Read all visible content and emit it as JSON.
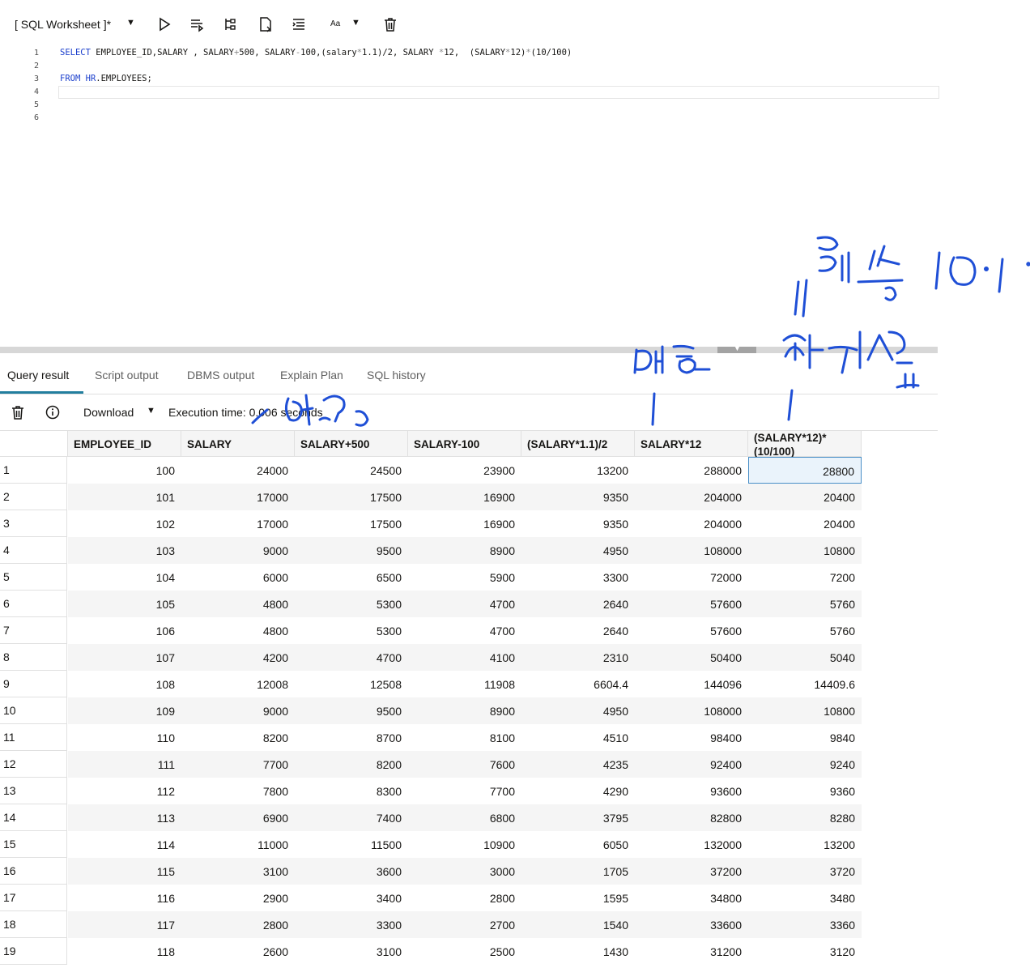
{
  "worksheet": {
    "title": "[ SQL Worksheet ]*",
    "font_button_label": "Aa"
  },
  "editor": {
    "line_numbers": [
      "1",
      "2",
      "3",
      "4",
      "5",
      "6"
    ],
    "line1": {
      "select": "SELECT",
      "cols": " EMPLOYEE_ID,SALARY , SALARY",
      "plus": "+",
      "p500": "500, SALARY",
      "minus": "-",
      "p100": "100,(salary",
      "star1": "*",
      "p11": "1.1)/2, SALARY ",
      "star2": "*",
      "p12": "12,  (SALARY",
      "star3": "*",
      "p12b": "12)",
      "star4": "*",
      "tail": "(10/100)"
    },
    "line3": {
      "from": "FROM",
      "space": " ",
      "schema": "HR",
      "table": ".EMPLOYEES;"
    }
  },
  "result_tabs": [
    "Query result",
    "Script output",
    "DBMS output",
    "Explain Plan",
    "SQL history"
  ],
  "result_toolbar": {
    "download_label": "Download",
    "execution_time": "Execution time: 0.006 seconds"
  },
  "grid": {
    "columns": [
      "EMPLOYEE_ID",
      "SALARY",
      "SALARY+500",
      "SALARY-100",
      "(SALARY*1.1)/2",
      "SALARY*12",
      "(SALARY*12)*(10/100)"
    ],
    "column_last_line1": "(SALARY*12)*",
    "column_last_line2": "(10/100)",
    "rows": [
      [
        "1",
        "100",
        "24000",
        "24500",
        "23900",
        "13200",
        "288000",
        "28800"
      ],
      [
        "2",
        "101",
        "17000",
        "17500",
        "16900",
        "9350",
        "204000",
        "20400"
      ],
      [
        "3",
        "102",
        "17000",
        "17500",
        "16900",
        "9350",
        "204000",
        "20400"
      ],
      [
        "4",
        "103",
        "9000",
        "9500",
        "8900",
        "4950",
        "108000",
        "10800"
      ],
      [
        "5",
        "104",
        "6000",
        "6500",
        "5900",
        "3300",
        "72000",
        "7200"
      ],
      [
        "6",
        "105",
        "4800",
        "5300",
        "4700",
        "2640",
        "57600",
        "5760"
      ],
      [
        "7",
        "106",
        "4800",
        "5300",
        "4700",
        "2640",
        "57600",
        "5760"
      ],
      [
        "8",
        "107",
        "4200",
        "4700",
        "4100",
        "2310",
        "50400",
        "5040"
      ],
      [
        "9",
        "108",
        "12008",
        "12508",
        "11908",
        "6604.4",
        "144096",
        "14409.6"
      ],
      [
        "10",
        "109",
        "9000",
        "9500",
        "8900",
        "4950",
        "108000",
        "10800"
      ],
      [
        "11",
        "110",
        "8200",
        "8700",
        "8100",
        "4510",
        "98400",
        "9840"
      ],
      [
        "12",
        "111",
        "7700",
        "8200",
        "7600",
        "4235",
        "92400",
        "9240"
      ],
      [
        "13",
        "112",
        "7800",
        "8300",
        "7700",
        "4290",
        "93600",
        "9360"
      ],
      [
        "14",
        "113",
        "6900",
        "7400",
        "6800",
        "3795",
        "82800",
        "8280"
      ],
      [
        "15",
        "114",
        "11000",
        "11500",
        "10900",
        "6050",
        "132000",
        "13200"
      ],
      [
        "16",
        "115",
        "3100",
        "3600",
        "3000",
        "1705",
        "37200",
        "3720"
      ],
      [
        "17",
        "116",
        "2900",
        "3400",
        "2800",
        "1595",
        "34800",
        "3480"
      ],
      [
        "18",
        "117",
        "2800",
        "3300",
        "2700",
        "1540",
        "33600",
        "3360"
      ],
      [
        "19",
        "118",
        "2600",
        "3100",
        "2500",
        "1430",
        "31200",
        "3120"
      ]
    ]
  },
  "colors": {
    "keyword": "#1a3ecc",
    "tab_accent": "#227e9e",
    "selected_cell_border": "#4a8fc7",
    "annotation_ink": "#1f4fd6"
  },
  "icons": [
    "caret-down-icon",
    "run-statement-icon",
    "run-script-icon",
    "explain-plan-icon",
    "autotrace-icon",
    "format-icon",
    "clear-icon",
    "trash-icon",
    "info-icon"
  ]
}
